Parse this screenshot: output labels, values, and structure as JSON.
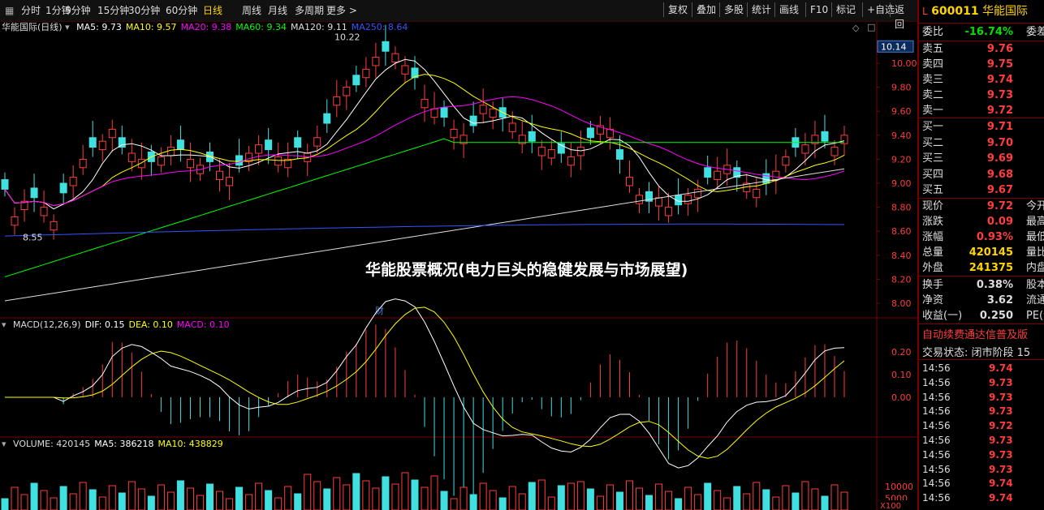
{
  "toolbar": {
    "periods": [
      "分时",
      "1分钟",
      "5分钟",
      "15分钟",
      "30分钟",
      "60分钟",
      "日线",
      "周线",
      "月线",
      "多周期",
      "更多 >"
    ],
    "active": "日线",
    "right_buttons": [
      "复权",
      "叠加",
      "多股",
      "统计",
      "画线",
      "F10",
      "标记",
      "+自选",
      "返回"
    ]
  },
  "kline": {
    "title": "华能国际(日线)",
    "ma_labels": [
      {
        "text": "MA5: 9.73",
        "color": "#ffffff"
      },
      {
        "text": "MA10: 9.57",
        "color": "#ffff00"
      },
      {
        "text": "MA20: 9.38",
        "color": "#ff00ff"
      },
      {
        "text": "MA60: 9.34",
        "color": "#00ff00"
      },
      {
        "text": "MA120: 9.11",
        "color": "#dddddd"
      },
      {
        "text": "MA250: 8.64",
        "color": "#3355ff"
      }
    ],
    "high_mark": "10.22",
    "low_mark": "8.55",
    "price_ticks": [
      "10.00",
      "9.80",
      "9.60",
      "9.40",
      "9.20",
      "9.00",
      "8.80",
      "8.60",
      "8.40",
      "8.20",
      "8.00"
    ],
    "current_price_tag": "10.14",
    "finance_marker": "财"
  },
  "macd": {
    "labels": [
      {
        "text": "MACD(12,26,9)",
        "color": "#dddddd"
      },
      {
        "text": "DIF: 0.15",
        "color": "#ffffff"
      },
      {
        "text": "DEA: 0.10",
        "color": "#ffff00"
      },
      {
        "text": "MACD: 0.10",
        "color": "#ff00ff"
      }
    ],
    "ticks": [
      "0.20",
      "0.10",
      "0.00"
    ]
  },
  "volume": {
    "labels": [
      {
        "text": "VOLUME: 420145",
        "color": "#dddddd"
      },
      {
        "text": "MA5: 386218",
        "color": "#ffffff"
      },
      {
        "text": "MA10: 438829",
        "color": "#ffff00"
      }
    ],
    "ticks": [
      "10000",
      "5000"
    ],
    "unit": "X100"
  },
  "overlay_title": "华能股票概况(电力巨头的稳健发展与市场展望)",
  "stock": {
    "badge": "L",
    "code": "600011",
    "name": "华能国际",
    "weibi_label": "委比",
    "weibi_value": "-16.74%",
    "weicha_label": "委差",
    "asks": [
      {
        "label": "卖五",
        "price": "9.76"
      },
      {
        "label": "卖四",
        "price": "9.75"
      },
      {
        "label": "卖三",
        "price": "9.74"
      },
      {
        "label": "卖二",
        "price": "9.73"
      },
      {
        "label": "卖一",
        "price": "9.72"
      }
    ],
    "bids": [
      {
        "label": "买一",
        "price": "9.71"
      },
      {
        "label": "买二",
        "price": "9.70"
      },
      {
        "label": "买三",
        "price": "9.69"
      },
      {
        "label": "买四",
        "price": "9.68"
      },
      {
        "label": "买五",
        "price": "9.67"
      }
    ],
    "quote": [
      {
        "label": "现价",
        "value": "9.72",
        "extra": "今开"
      },
      {
        "label": "涨跌",
        "value": "0.09",
        "extra": "最高"
      },
      {
        "label": "涨幅",
        "value": "0.93%",
        "extra": "最低"
      },
      {
        "label": "总量",
        "value": "420145",
        "extra": "量比"
      },
      {
        "label": "外盘",
        "value": "241375",
        "extra": "内盘"
      }
    ],
    "stats": [
      {
        "label": "换手",
        "value": "0.38%",
        "extra": "股本"
      },
      {
        "label": "净资",
        "value": "3.62",
        "extra": "流通"
      },
      {
        "label": "收益(一)",
        "value": "0.250",
        "extra": "PE(动"
      }
    ],
    "ad_text": "自动续费通达信普及版",
    "trade_status": "交易状态: 闭市阶段 15",
    "ticks": [
      {
        "time": "14:56",
        "price": "9.74"
      },
      {
        "time": "14:56",
        "price": "9.73"
      },
      {
        "time": "14:56",
        "price": "9.73"
      },
      {
        "time": "14:56",
        "price": "9.73"
      },
      {
        "time": "14:56",
        "price": "9.72"
      },
      {
        "time": "14:56",
        "price": "9.73"
      },
      {
        "time": "14:56",
        "price": "9.73"
      },
      {
        "time": "14:56",
        "price": "9.73"
      },
      {
        "time": "14:56",
        "price": "9.74"
      },
      {
        "time": "14:56",
        "price": "9.74"
      }
    ]
  }
}
